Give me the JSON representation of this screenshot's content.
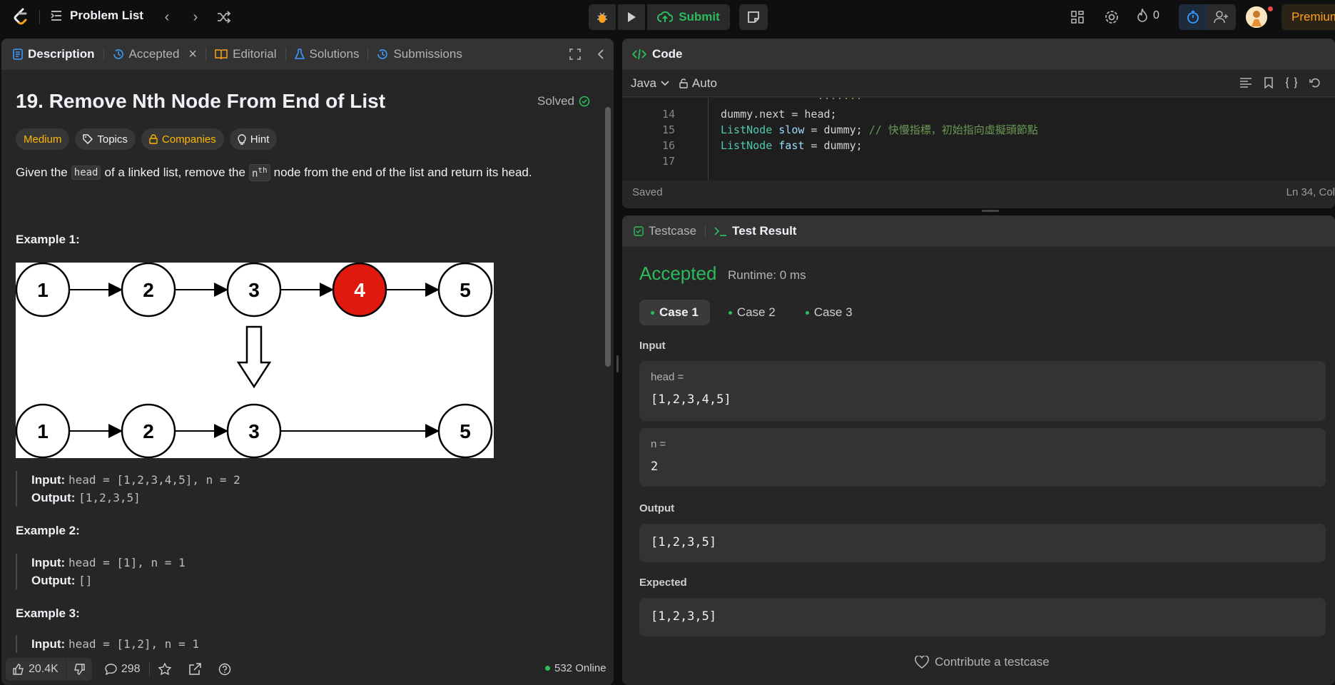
{
  "topbar": {
    "problem_list": "Problem List",
    "submit": "Submit",
    "streak_count": "0",
    "premium": "Premium"
  },
  "left_tabs": [
    {
      "label": "Description"
    },
    {
      "label": "Accepted"
    },
    {
      "label": "Editorial"
    },
    {
      "label": "Solutions"
    },
    {
      "label": "Submissions"
    }
  ],
  "problem": {
    "title": "19. Remove Nth Node From End of List",
    "status": "Solved",
    "difficulty": "Medium",
    "topics": "Topics",
    "companies": "Companies",
    "hint": "Hint",
    "desc_pre": "Given the",
    "desc_code1": "head",
    "desc_mid": "of a linked list, remove the",
    "desc_code2": "nth",
    "desc_post": "node from the end of the list and return its head."
  },
  "examples": [
    {
      "title": "Example 1:",
      "input_label": "Input:",
      "input": "head = [1,2,3,4,5], n = 2",
      "output_label": "Output:",
      "output": "[1,2,3,5]"
    },
    {
      "title": "Example 2:",
      "input_label": "Input:",
      "input": "head = [1], n = 1",
      "output_label": "Output:",
      "output": "[]"
    },
    {
      "title": "Example 3:",
      "input_label": "Input:",
      "input": "head = [1,2], n = 1"
    }
  ],
  "diagram": {
    "top_nodes": [
      "1",
      "2",
      "3",
      "4",
      "5"
    ],
    "bottom_nodes": [
      "1",
      "2",
      "3",
      "5"
    ],
    "removed_color": "#e0190f"
  },
  "footer": {
    "likes": "20.4K",
    "comments": "298",
    "online": "532 Online"
  },
  "code_panel": {
    "tab": "Code",
    "language": "Java",
    "mode": "Auto",
    "lines": [
      {
        "num": "14",
        "text": "dummy.next = head;"
      },
      {
        "num": "15",
        "text_kw": "ListNode",
        "text_id": "slow",
        "text_rest": " = dummy; ",
        "comment": "// 快慢指標，初始指向虛擬頭節點"
      },
      {
        "num": "16",
        "text_kw": "ListNode",
        "text_id": "fast",
        "text_rest": " = dummy;"
      },
      {
        "num": "17",
        "text": ""
      }
    ],
    "saved": "Saved",
    "cursor": "Ln 34, Col"
  },
  "result_panel": {
    "tab_testcase": "Testcase",
    "tab_result": "Test Result",
    "status": "Accepted",
    "runtime": "Runtime: 0 ms",
    "cases": [
      "Case 1",
      "Case 2",
      "Case 3"
    ],
    "input_label": "Input",
    "head_label": "head =",
    "head_value": "[1,2,3,4,5]",
    "n_label": "n =",
    "n_value": "2",
    "output_label": "Output",
    "output_value": "[1,2,3,5]",
    "expected_label": "Expected",
    "expected_value": "[1,2,3,5]",
    "contribute": "Contribute a testcase"
  },
  "colors": {
    "accent_green": "#2cbb5d",
    "medium_yellow": "#ffb700",
    "premium_orange": "#ffa116"
  }
}
